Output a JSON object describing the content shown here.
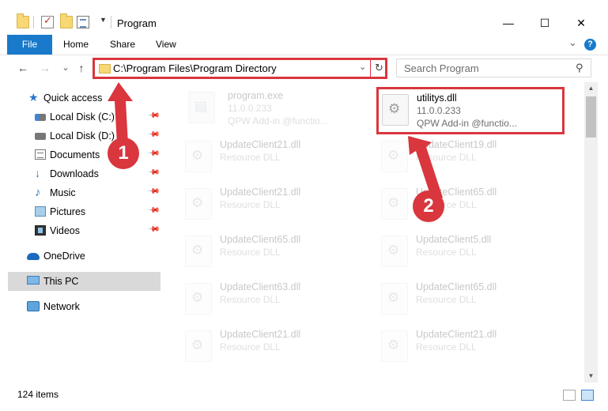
{
  "window": {
    "title": "Program",
    "minimize_icon": "minimize-icon",
    "maximize_icon": "maximize-icon",
    "close_icon": "close-icon",
    "min_glyph": "—",
    "max_glyph": "☐",
    "close_glyph": "✕"
  },
  "ribbon": {
    "tabs": [
      "File",
      "Home",
      "Share",
      "View"
    ],
    "expand_glyph": "⌄",
    "help_glyph": "?"
  },
  "nav": {
    "back_glyph": "←",
    "forward_glyph": "→",
    "recent_glyph": "⌄",
    "up_glyph": "↑",
    "address": "C:\\Program Files\\Program Directory",
    "dropdown_glyph": "⌄",
    "refresh_glyph": "↻",
    "search_placeholder": "Search Program",
    "search_glyph": "⚲"
  },
  "sidebar": {
    "items": [
      {
        "label": "Quick access",
        "icon": "star-icon"
      },
      {
        "label": "Local Disk (C:)",
        "icon": "drive-c-icon"
      },
      {
        "label": "Local Disk (D:)",
        "icon": "drive-d-icon"
      },
      {
        "label": "Documents",
        "icon": "documents-icon"
      },
      {
        "label": "Downloads",
        "icon": "downloads-icon"
      },
      {
        "label": "Music",
        "icon": "music-icon"
      },
      {
        "label": "Pictures",
        "icon": "pictures-icon"
      },
      {
        "label": "Videos",
        "icon": "videos-icon"
      },
      {
        "label": "OneDrive",
        "icon": "onedrive-icon"
      },
      {
        "label": "This PC",
        "icon": "this-pc-icon"
      },
      {
        "label": "Network",
        "icon": "network-icon"
      }
    ],
    "pin_glyph": "📌"
  },
  "files": [
    {
      "name": "program.exe",
      "line1": "11.0.0.233",
      "line2": "QPW Add-in @functio..."
    },
    {
      "name": "utilitys.dll",
      "line1": "11.0.0.233",
      "line2": "QPW Add-in @functio..."
    },
    {
      "name": "UpdateClient21.dll",
      "line1": "Resource DLL"
    },
    {
      "name": "UpdateClient19.dll",
      "line1": "Resource DLL"
    },
    {
      "name": "UpdateClient21.dll",
      "line1": "Resource DLL"
    },
    {
      "name": "UpdateClient65.dll",
      "line1": "Resource DLL"
    },
    {
      "name": "UpdateClient65.dll",
      "line1": "Resource DLL"
    },
    {
      "name": "UpdateClient5.dll",
      "line1": "Resource DLL"
    },
    {
      "name": "UpdateClient63.dll",
      "line1": "Resource DLL"
    },
    {
      "name": "UpdateClient65.dll",
      "line1": "Resource DLL"
    },
    {
      "name": "UpdateClient21.dll",
      "line1": "Resource DLL"
    },
    {
      "name": "UpdateClient21.dll",
      "line1": "Resource DLL"
    }
  ],
  "status": {
    "item_count": "124 items"
  },
  "annotations": {
    "badge_1": "1",
    "badge_2": "2",
    "color": "#d9363e"
  },
  "colors": {
    "accent": "#1979ca",
    "highlight": "#d9363e"
  }
}
